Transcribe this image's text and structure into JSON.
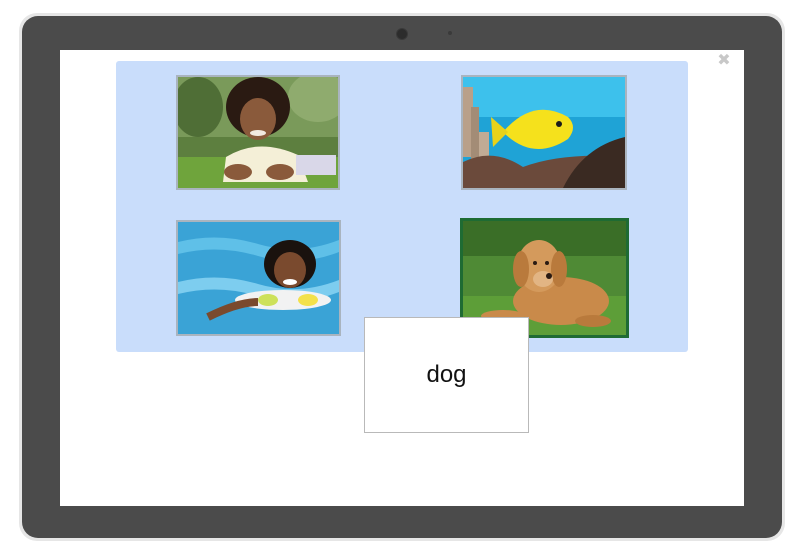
{
  "activity": {
    "word_card": {
      "label": "dog"
    },
    "close_icon": "close-icon",
    "images": [
      {
        "name": "child-in-grass",
        "selected": false
      },
      {
        "name": "yellow-tang-fish",
        "selected": false
      },
      {
        "name": "child-swimming",
        "selected": false
      },
      {
        "name": "golden-retriever-dog",
        "selected": true
      }
    ]
  },
  "colors": {
    "board_background": "#c9ddfb",
    "selected_border": "#1e6b33",
    "tablet_bezel": "#4b4b4b"
  }
}
